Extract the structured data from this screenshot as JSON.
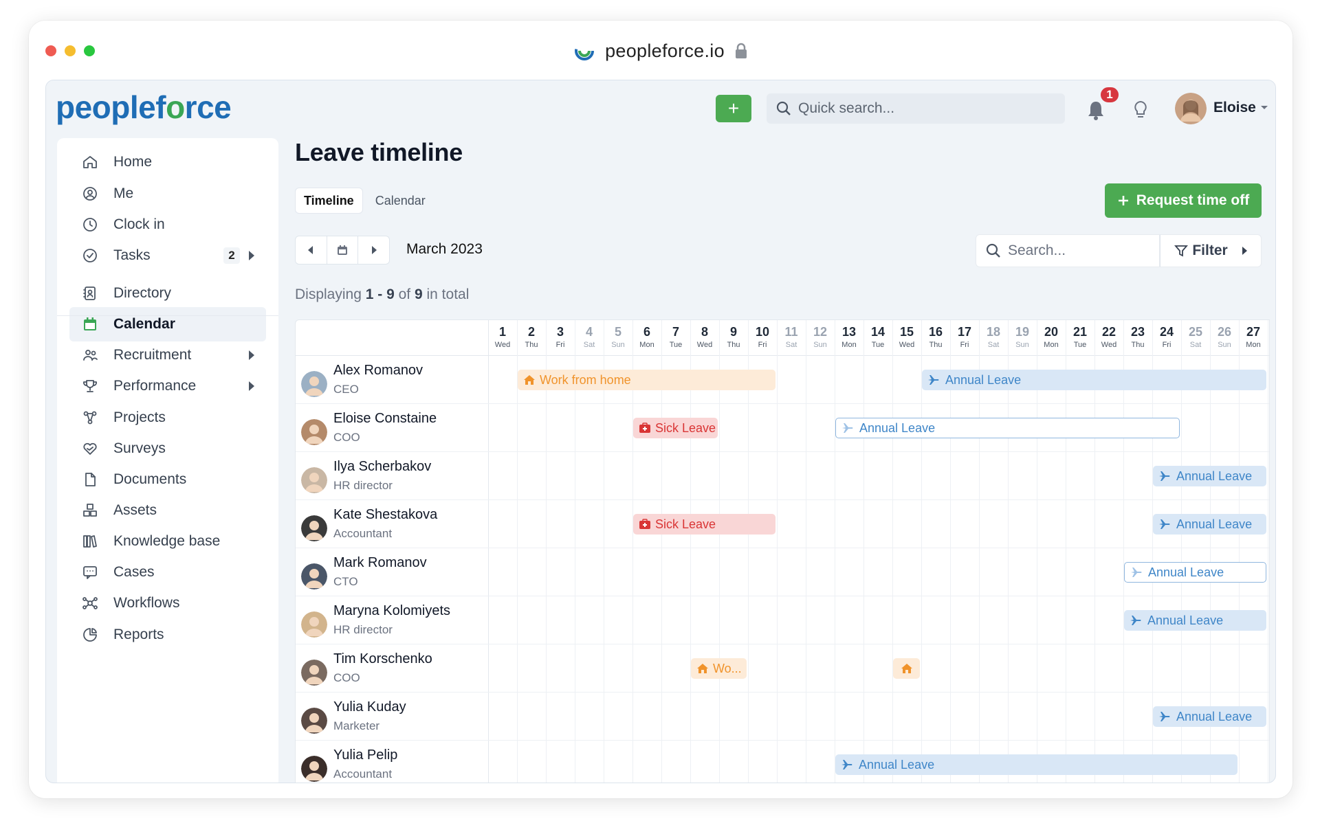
{
  "browser": {
    "url": "peopleforce.io"
  },
  "brand": {
    "part1": "peopleforce",
    "part2": ""
  },
  "topbar": {
    "quick_search_placeholder": "Quick search...",
    "notifications_count": "1",
    "user_name": "Eloise"
  },
  "sidebar": {
    "items": [
      {
        "label": "Home",
        "icon": "home-icon"
      },
      {
        "label": "Me",
        "icon": "user-icon"
      },
      {
        "label": "Clock in",
        "icon": "clock-icon"
      },
      {
        "label": "Tasks",
        "icon": "check-circle-icon",
        "count": "2"
      },
      {
        "label": "Directory",
        "icon": "directory-icon"
      },
      {
        "label": "Calendar",
        "icon": "calendar-icon"
      },
      {
        "label": "Recruitment",
        "icon": "people-icon"
      },
      {
        "label": "Performance",
        "icon": "trophy-icon"
      },
      {
        "label": "Projects",
        "icon": "projects-icon"
      },
      {
        "label": "Surveys",
        "icon": "heart-icon"
      },
      {
        "label": "Documents",
        "icon": "document-icon"
      },
      {
        "label": "Assets",
        "icon": "assets-icon"
      },
      {
        "label": "Knowledge base",
        "icon": "books-icon"
      },
      {
        "label": "Cases",
        "icon": "chat-icon"
      },
      {
        "label": "Workflows",
        "icon": "workflow-icon"
      },
      {
        "label": "Reports",
        "icon": "pie-chart-icon"
      }
    ]
  },
  "page": {
    "title": "Leave timeline",
    "tabs": [
      "Timeline",
      "Calendar"
    ],
    "request_btn": "Request time off",
    "month": "March 2023",
    "search_placeholder": "Search...",
    "filter_label": "Filter",
    "displaying": {
      "prefix": "Displaying",
      "range": "1 - 9",
      "of": "of",
      "total": "9",
      "suffix": "in total"
    }
  },
  "colors": {
    "accent_green": "#4caa52",
    "brand_blue": "#1f6db5",
    "wfh": "#f0932b",
    "sick": "#d93535",
    "annual": "#3f86c8"
  },
  "days": [
    {
      "n": "1",
      "d": "Wed"
    },
    {
      "n": "2",
      "d": "Thu"
    },
    {
      "n": "3",
      "d": "Fri"
    },
    {
      "n": "4",
      "d": "Sat",
      "w": true
    },
    {
      "n": "5",
      "d": "Sun",
      "w": true
    },
    {
      "n": "6",
      "d": "Mon"
    },
    {
      "n": "7",
      "d": "Tue"
    },
    {
      "n": "8",
      "d": "Wed"
    },
    {
      "n": "9",
      "d": "Thu"
    },
    {
      "n": "10",
      "d": "Fri"
    },
    {
      "n": "11",
      "d": "Sat",
      "w": true
    },
    {
      "n": "12",
      "d": "Sun",
      "w": true
    },
    {
      "n": "13",
      "d": "Mon"
    },
    {
      "n": "14",
      "d": "Tue"
    },
    {
      "n": "15",
      "d": "Wed"
    },
    {
      "n": "16",
      "d": "Thu"
    },
    {
      "n": "17",
      "d": "Fri"
    },
    {
      "n": "18",
      "d": "Sat",
      "w": true
    },
    {
      "n": "19",
      "d": "Sun",
      "w": true
    },
    {
      "n": "20",
      "d": "Mon"
    },
    {
      "n": "21",
      "d": "Tue"
    },
    {
      "n": "22",
      "d": "Wed"
    },
    {
      "n": "23",
      "d": "Thu"
    },
    {
      "n": "24",
      "d": "Fri"
    },
    {
      "n": "25",
      "d": "Sat",
      "w": true
    },
    {
      "n": "26",
      "d": "Sun",
      "w": true
    },
    {
      "n": "27",
      "d": "Mon"
    }
  ],
  "people": [
    {
      "name": "Alex Romanov",
      "role": "CEO",
      "avatar": "#9bb0c4",
      "leaves": [
        {
          "type": "wfh",
          "label": "Work from home",
          "start": 2,
          "end": 10
        },
        {
          "type": "annual",
          "label": "Annual Leave",
          "start": 16,
          "end": 27
        }
      ]
    },
    {
      "name": "Eloise Constaine",
      "role": "COO",
      "avatar": "#b48a6a",
      "leaves": [
        {
          "type": "sick",
          "label": "Sick Leave",
          "start": 6,
          "end": 8
        },
        {
          "type": "annual-outline",
          "label": "Annual Leave",
          "start": 13,
          "end": 24
        }
      ]
    },
    {
      "name": "Ilya Scherbakov",
      "role": "HR director",
      "avatar": "#c9b7a4",
      "leaves": [
        {
          "type": "annual",
          "label": "Annual Leave",
          "start": 24,
          "end": 27
        }
      ]
    },
    {
      "name": "Kate Shestakova",
      "role": "Accountant",
      "avatar": "#3a3a3a",
      "leaves": [
        {
          "type": "sick",
          "label": "Sick Leave",
          "start": 6,
          "end": 10
        },
        {
          "type": "annual",
          "label": "Annual Leave",
          "start": 24,
          "end": 27
        }
      ]
    },
    {
      "name": "Mark Romanov",
      "role": "CTO",
      "avatar": "#4a5668",
      "leaves": [
        {
          "type": "annual-outline",
          "label": "Annual Leave",
          "start": 23,
          "end": 27
        }
      ]
    },
    {
      "name": "Maryna Kolomiyets",
      "role": "HR director",
      "avatar": "#d2b48c",
      "leaves": [
        {
          "type": "annual",
          "label": "Annual Leave",
          "start": 23,
          "end": 27
        }
      ]
    },
    {
      "name": "Tim Korschenko",
      "role": "COO",
      "avatar": "#7a6a60",
      "leaves": [
        {
          "type": "wfh",
          "label": "Wo...",
          "start": 8,
          "end": 9
        },
        {
          "type": "wfh",
          "label": "",
          "start": 15,
          "end": 15
        }
      ]
    },
    {
      "name": "Yulia Kuday",
      "role": "Marketer",
      "avatar": "#5a4a44",
      "leaves": [
        {
          "type": "annual",
          "label": "Annual Leave",
          "start": 24,
          "end": 27
        }
      ]
    },
    {
      "name": "Yulia Pelip",
      "role": "Accountant",
      "avatar": "#3b2e2a",
      "leaves": [
        {
          "type": "annual",
          "label": "Annual Leave",
          "start": 13,
          "end": 26
        }
      ]
    }
  ]
}
